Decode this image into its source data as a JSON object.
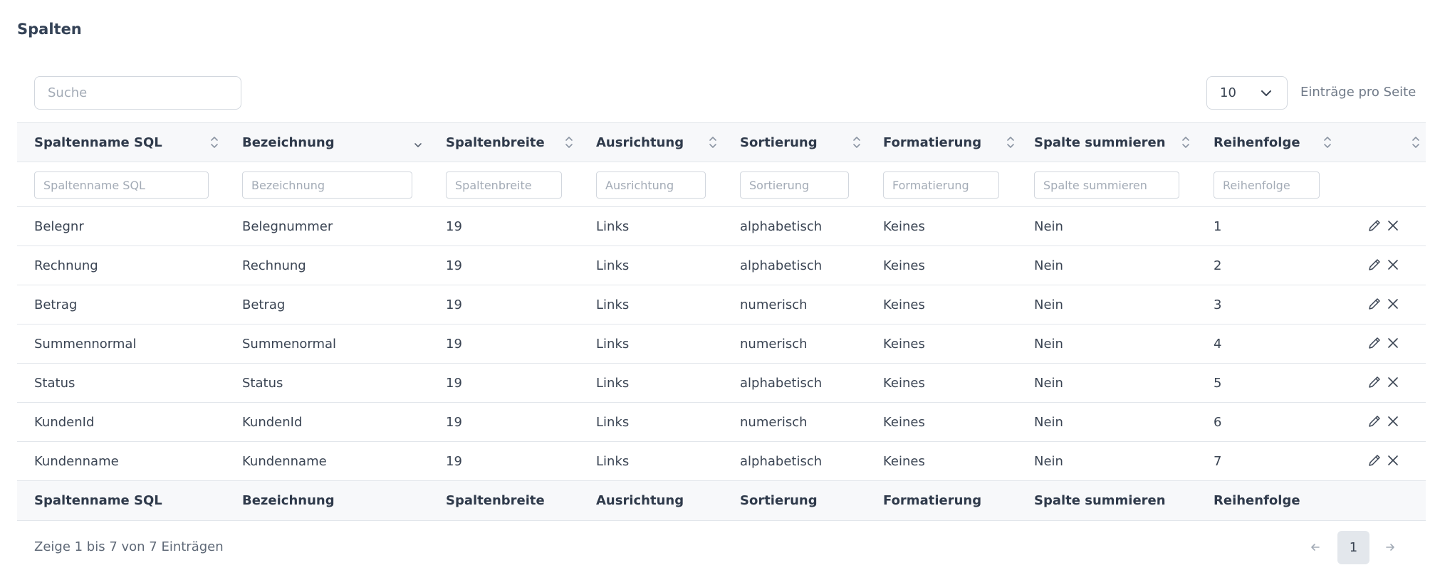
{
  "page": {
    "title": "Spalten"
  },
  "search": {
    "placeholder": "Suche"
  },
  "page_size": {
    "value": "10",
    "label": "Einträge pro Seite"
  },
  "columns": [
    "Spaltenname SQL",
    "Bezeichnung",
    "Spaltenbreite",
    "Ausrichtung",
    "Sortierung",
    "Formatierung",
    "Spalte summieren",
    "Reihenfolge"
  ],
  "filters": [
    "Spaltenname SQL",
    "Bezeichnung",
    "Spaltenbreite",
    "Ausrichtung",
    "Sortierung",
    "Formatierung",
    "Spalte summieren",
    "Reihenfolge"
  ],
  "rows": [
    [
      "Belegnr",
      "Belegnummer",
      "19",
      "Links",
      "alphabetisch",
      "Keines",
      "Nein",
      "1"
    ],
    [
      "Rechnung",
      "Rechnung",
      "19",
      "Links",
      "alphabetisch",
      "Keines",
      "Nein",
      "2"
    ],
    [
      "Betrag",
      "Betrag",
      "19",
      "Links",
      "numerisch",
      "Keines",
      "Nein",
      "3"
    ],
    [
      "Summennormal",
      "Summenormal",
      "19",
      "Links",
      "numerisch",
      "Keines",
      "Nein",
      "4"
    ],
    [
      "Status",
      "Status",
      "19",
      "Links",
      "alphabetisch",
      "Keines",
      "Nein",
      "5"
    ],
    [
      "KundenId",
      "KundenId",
      "19",
      "Links",
      "numerisch",
      "Keines",
      "Nein",
      "6"
    ],
    [
      "Kundenname",
      "Kundenname",
      "19",
      "Links",
      "alphabetisch",
      "Keines",
      "Nein",
      "7"
    ]
  ],
  "footer_columns": [
    "Spaltenname SQL",
    "Bezeichnung",
    "Spaltenbreite",
    "Ausrichtung",
    "Sortierung",
    "Formatierung",
    "Spalte summieren",
    "Reihenfolge"
  ],
  "info": "Zeige 1 bis 7 von 7 Einträgen",
  "pagination": {
    "prev": "←",
    "current": "1",
    "next": "→"
  },
  "icons": {
    "sort": "sort-updown-icon",
    "sort_active": "sort-desc-icon",
    "edit": "pencil-icon",
    "delete": "close-icon",
    "dropdown": "chevron-down-icon"
  }
}
